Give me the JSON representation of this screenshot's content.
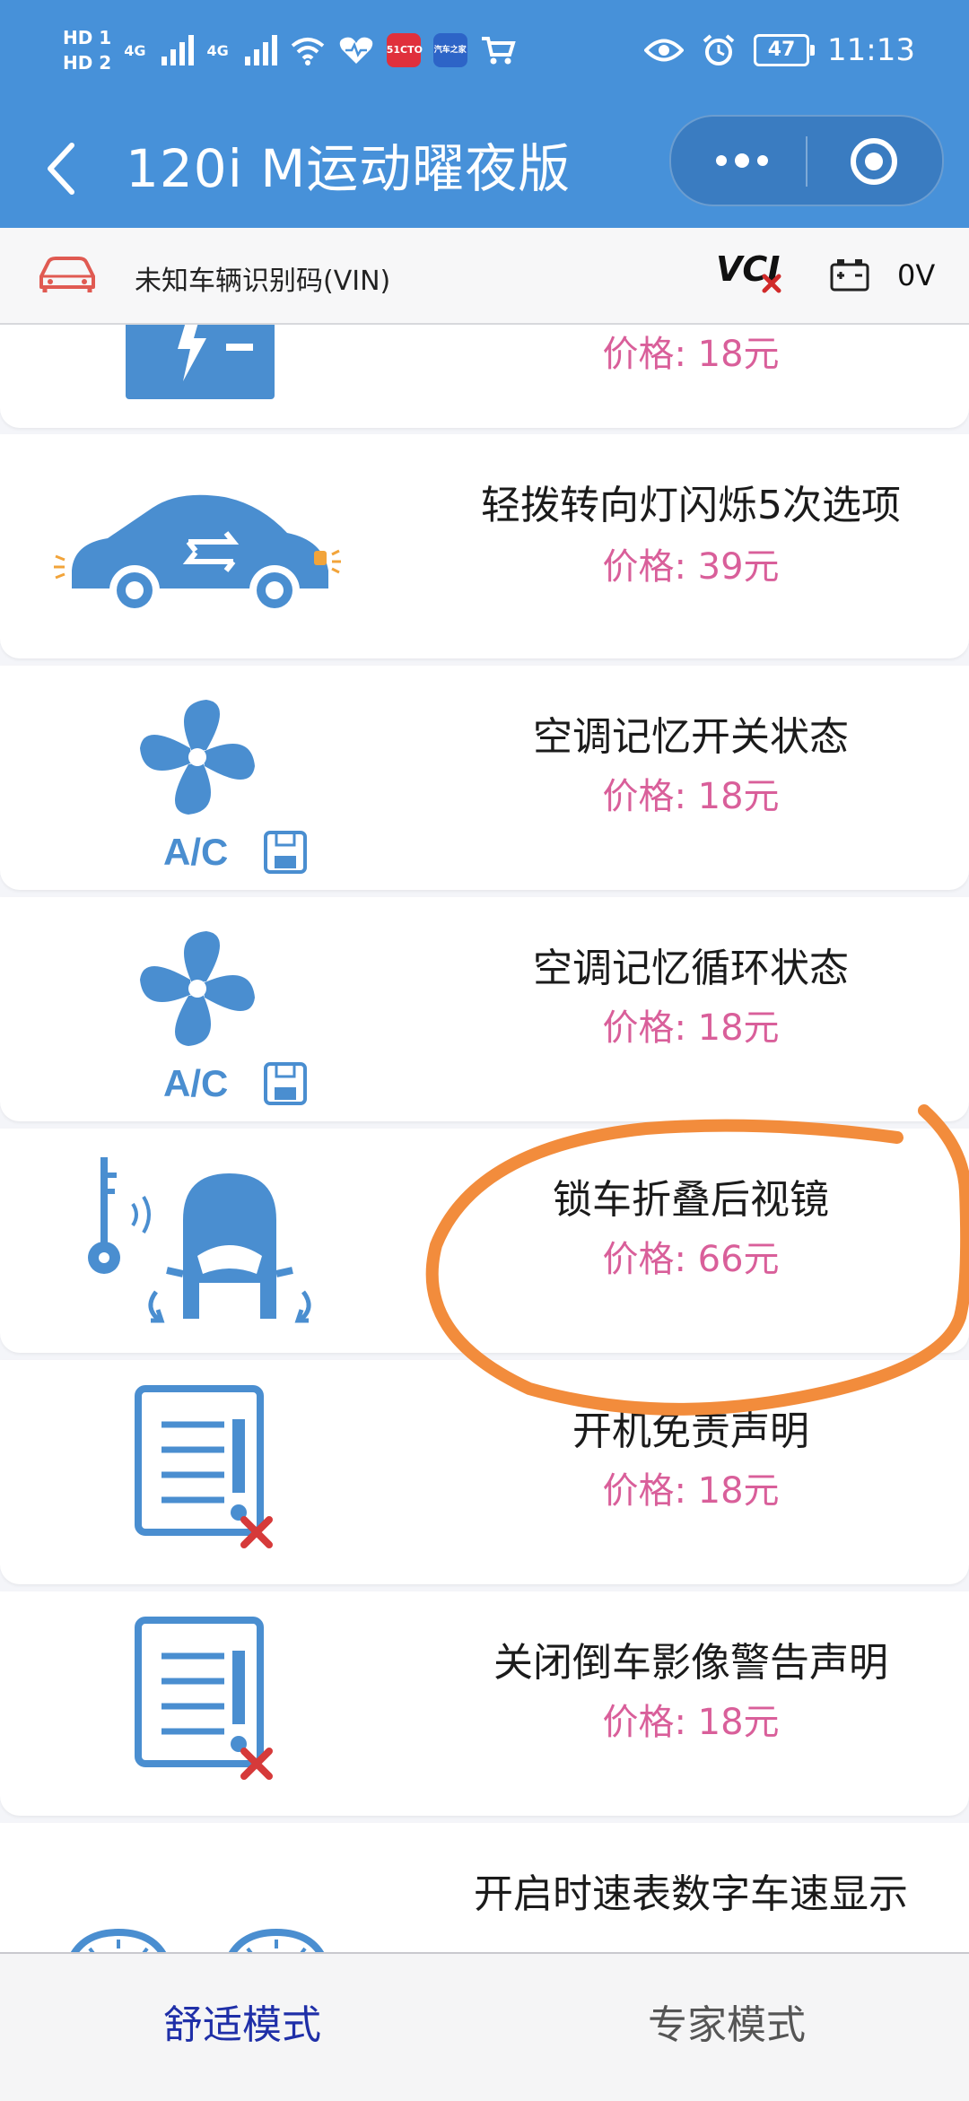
{
  "status_bar": {
    "hd1": "HD 1",
    "hd2": "HD 2",
    "signal1": "4G",
    "signal2": "4G",
    "app_badge1": "51CTO",
    "app_badge2": "汽车之家",
    "battery": "47",
    "time": "11:13"
  },
  "header": {
    "title": "120i M运动曜夜版"
  },
  "info_bar": {
    "vin": "未知车辆识别码(VIN)",
    "vci": "VCI",
    "voltage": "0V"
  },
  "items": [
    {
      "name": "",
      "price": "价格: 18元",
      "icon": "battery-icon"
    },
    {
      "name": "轻拨转向灯闪烁5次选项",
      "price": "价格: 39元",
      "icon": "car-turn-signal-icon"
    },
    {
      "name": "空调记忆开关状态",
      "price": "价格: 18元",
      "icon": "ac-fan-icon"
    },
    {
      "name": "空调记忆循环状态",
      "price": "价格: 18元",
      "icon": "ac-fan-icon"
    },
    {
      "name": "锁车折叠后视镜",
      "price": "价格: 66元",
      "icon": "key-mirror-fold-icon"
    },
    {
      "name": "开机免责声明",
      "price": "价格: 18元",
      "icon": "document-warning-icon"
    },
    {
      "name": "关闭倒车影像警告声明",
      "price": "价格: 18元",
      "icon": "document-warning-icon"
    },
    {
      "name": "开启时速表数字车速显示",
      "price": "",
      "icon": "speedometer-icon"
    }
  ],
  "tabs": {
    "comfort": "舒适模式",
    "expert": "专家模式"
  },
  "colors": {
    "brand_blue": "#4791d9",
    "price_pink": "#d95f9a",
    "icon_blue": "#4a8ed0",
    "annotation_orange": "#f28c3c",
    "tab_active": "#1f2fa8"
  }
}
